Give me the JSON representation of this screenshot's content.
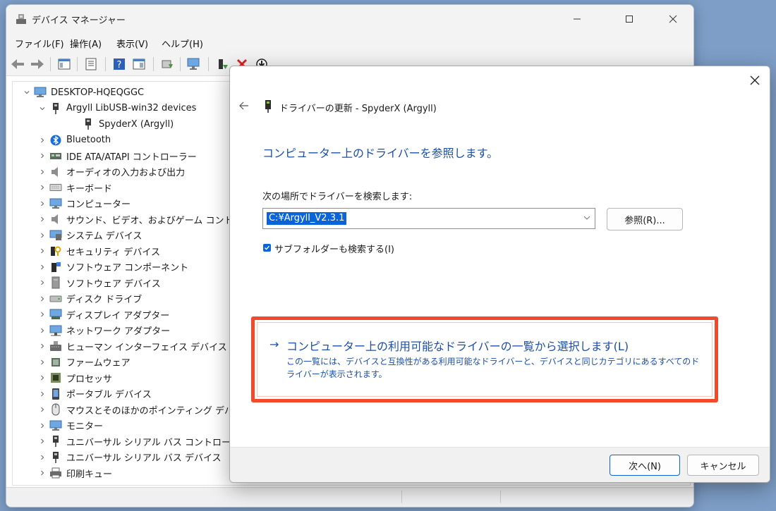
{
  "window": {
    "title": "デバイス マネージャー",
    "menu": [
      "ファイル(F)",
      "操作(A)",
      "表示(V)",
      "ヘルプ(H)"
    ]
  },
  "tree": {
    "root": "DESKTOP-HQEQGGC",
    "items": [
      {
        "label": "Argyll LibUSB-win32 devices",
        "expanded": true,
        "icon": "usb-plug-icon"
      },
      {
        "label": "SpyderX (Argyll)",
        "child": true,
        "icon": "usb-plug-icon"
      },
      {
        "label": "Bluetooth",
        "icon": "bluetooth-icon"
      },
      {
        "label": "IDE ATA/ATAPI コントローラー",
        "icon": "ide-controller-icon"
      },
      {
        "label": "オーディオの入力および出力",
        "icon": "speaker-icon"
      },
      {
        "label": "キーボード",
        "icon": "keyboard-icon"
      },
      {
        "label": "コンピューター",
        "icon": "computer-icon"
      },
      {
        "label": "サウンド、ビデオ、およびゲーム コントローラー",
        "icon": "speaker-icon"
      },
      {
        "label": "システム デバイス",
        "icon": "system-device-icon"
      },
      {
        "label": "セキュリティ デバイス",
        "icon": "security-key-icon"
      },
      {
        "label": "ソフトウェア コンポーネント",
        "icon": "software-component-icon"
      },
      {
        "label": "ソフトウェア デバイス",
        "icon": "software-device-icon"
      },
      {
        "label": "ディスク ドライブ",
        "icon": "disk-drive-icon"
      },
      {
        "label": "ディスプレイ アダプター",
        "icon": "display-adapter-icon"
      },
      {
        "label": "ネットワーク アダプター",
        "icon": "network-adapter-icon"
      },
      {
        "label": "ヒューマン インターフェイス デバイス",
        "icon": "hid-icon"
      },
      {
        "label": "ファームウェア",
        "icon": "firmware-icon"
      },
      {
        "label": "プロセッサ",
        "icon": "processor-icon"
      },
      {
        "label": "ポータブル デバイス",
        "icon": "portable-device-icon"
      },
      {
        "label": "マウスとそのほかのポインティング デバイス",
        "icon": "mouse-icon"
      },
      {
        "label": "モニター",
        "icon": "monitor-icon"
      },
      {
        "label": "ユニバーサル シリアル バス コントローラー",
        "icon": "usb-plug-icon"
      },
      {
        "label": "ユニバーサル シリアル バス デバイス",
        "icon": "usb-plug-icon"
      },
      {
        "label": "印刷キュー",
        "icon": "printer-icon"
      }
    ]
  },
  "dialog": {
    "title": "ドライバーの更新 - SpyderX (Argyll)",
    "heading": "コンピューター上のドライバーを参照します。",
    "search_label": "次の場所でドライバーを検索します:",
    "path_value": "C:¥Argyll_V2.3.1",
    "browse_label": "参照(R)...",
    "subfolder_label": "サブフォルダーも検索する(I)",
    "subfolder_checked": true,
    "pick_arrow": "→",
    "pick_title": "コンピューター上の利用可能なドライバーの一覧から選択します(L)",
    "pick_desc": "この一覧には、デバイスと互換性がある利用可能なドライバーと、デバイスと同じカテゴリにあるすべてのドライバーが表示されます。",
    "next_label": "次へ(N)",
    "cancel_label": "キャンセル"
  },
  "colors": {
    "accent": "#0a64d8",
    "link_text": "#1c4fa8",
    "highlight_box": "#f0492b"
  }
}
